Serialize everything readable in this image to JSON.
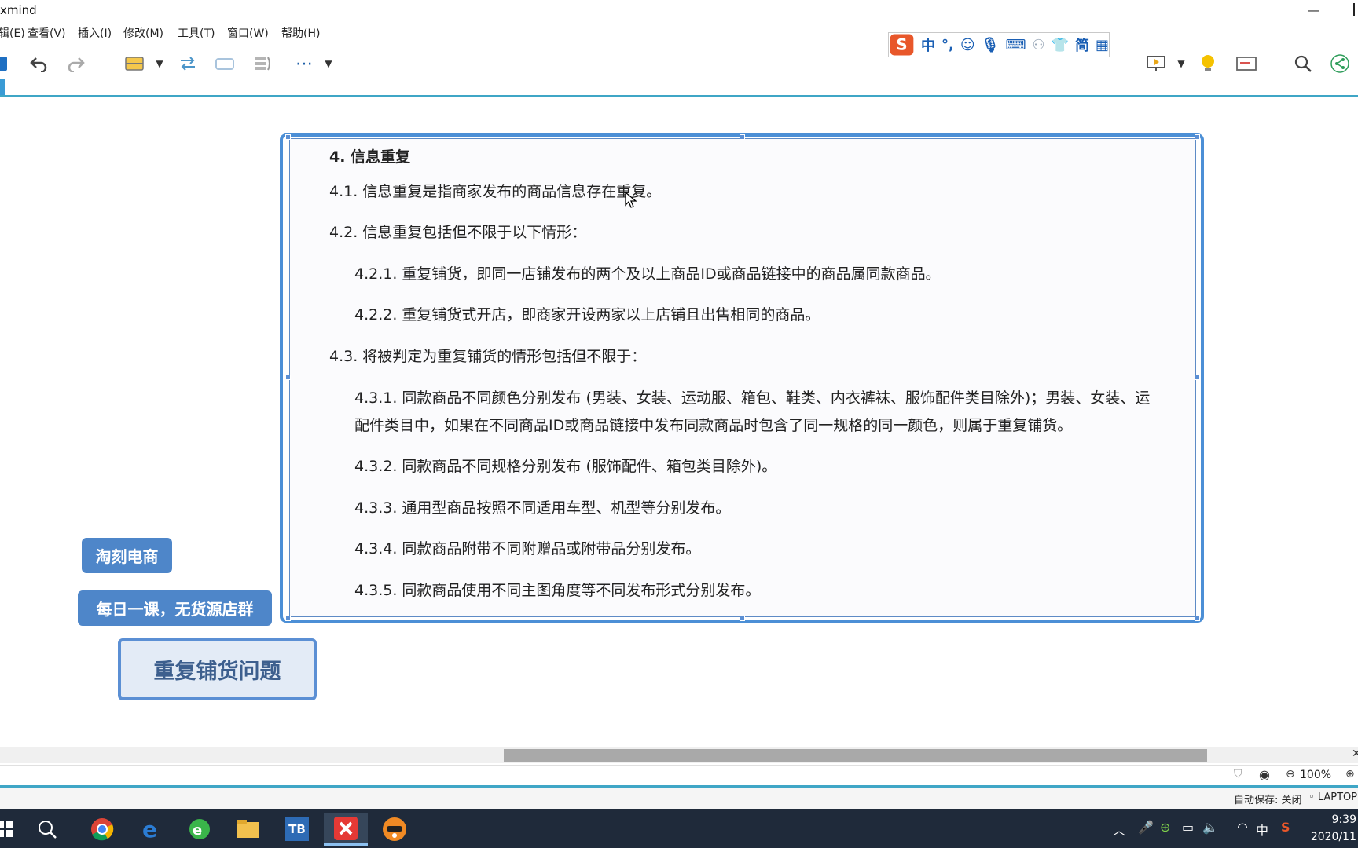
{
  "window": {
    "title": "xmind",
    "minimize": "—"
  },
  "menu": {
    "items": [
      {
        "label": "编辑(E)"
      },
      {
        "label": "查看(V)"
      },
      {
        "label": "插入(I)"
      },
      {
        "label": "修改(M)"
      },
      {
        "label": "工具(T)"
      },
      {
        "label": "窗口(W)"
      },
      {
        "label": "帮助(H)"
      }
    ]
  },
  "ime": {
    "logo": "S",
    "mode": "中",
    "punct": "°,",
    "simplified": "简"
  },
  "document": {
    "lines": [
      "4.   信息重复",
      "4.1.      信息重复是指商家发布的商品信息存在重复。",
      "4.2.      信息重复包括但不限于以下情形：",
      "4.2.1.  重复铺货，即同一店铺发布的两个及以上商品ID或商品链接中的商品属同款商品。",
      "4.2.2.  重复铺货式开店，即商家开设两家以上店铺且出售相同的商品。",
      "4.3.      将被判定为重复铺货的情形包括但不限于：",
      "4.3.1.  同款商品不同颜色分别发布 (男装、女装、运动服、箱包、鞋类、内衣裤袜、服饰配件类目除外)；男装、女装、运",
      "配件类目中，如果在不同商品ID或商品链接中发布同款商品时包含了同一规格的同一颜色，则属于重复铺货。",
      "4.3.2.  同款商品不同规格分别发布 (服饰配件、箱包类目除外)。",
      "4.3.3.  通用型商品按照不同适用车型、机型等分别发布。",
      "4.3.4.  同款商品附带不同附赠品或附带品分别发布。",
      "4.3.5.  同款商品使用不同主图角度等不同发布形式分别发布。"
    ]
  },
  "topics": {
    "label1": "淘刻电商",
    "label2": "每日一课，无货源店群",
    "main": "重复铺货问题"
  },
  "status": {
    "zoom": "100%",
    "autosave": "自动保存: 关闭",
    "machine": "LAPTOP"
  },
  "taskbar": {
    "tb_label": "TB",
    "tray_ime": "中",
    "time": "9:39",
    "date": "2020/11"
  },
  "colors": {
    "accent": "#4c8fd6",
    "topic_fill": "#4e86c9",
    "main_topic_fill": "#e3ebf6",
    "divider": "#3fa6c6"
  }
}
